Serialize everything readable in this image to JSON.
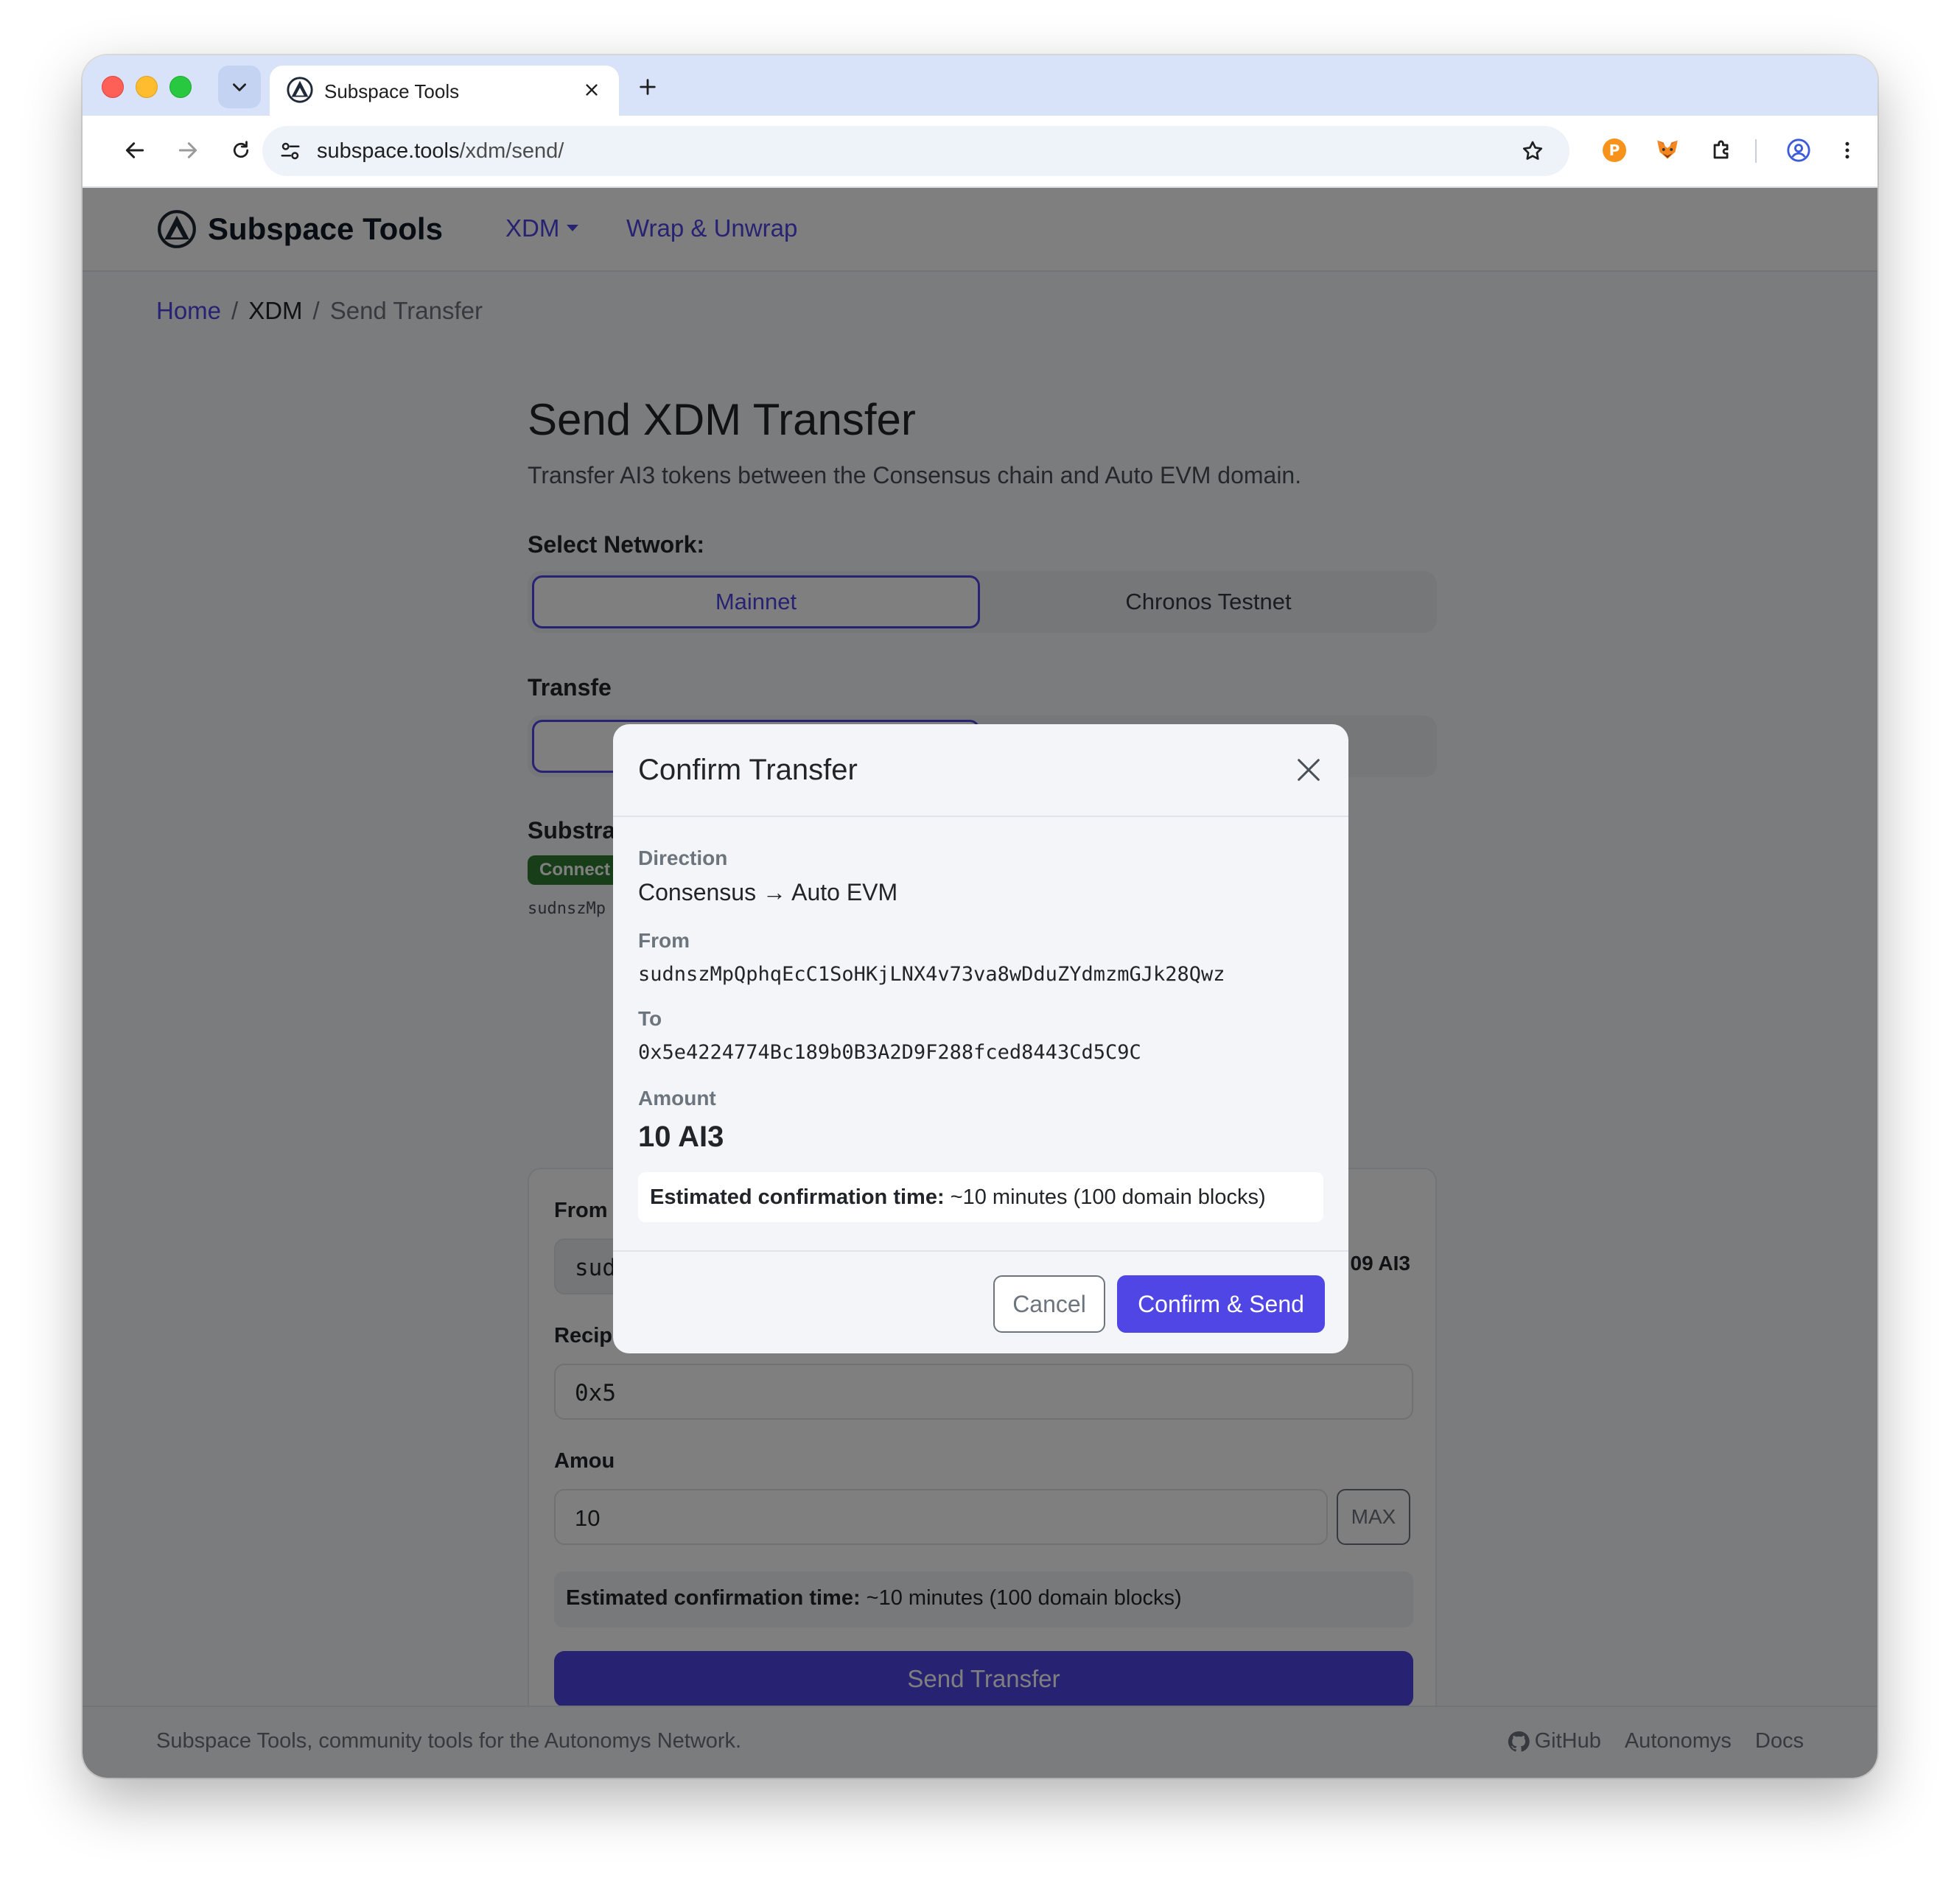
{
  "browser": {
    "tab_title": "Subspace Tools",
    "url_host": "subspace.tools",
    "url_path": "/xdm/send/"
  },
  "nav": {
    "brand": "Subspace Tools",
    "links": [
      "XDM",
      "Wrap & Unwrap"
    ]
  },
  "breadcrumb": [
    "Home",
    "XDM",
    "Send Transfer"
  ],
  "main": {
    "title": "Send XDM Transfer",
    "subtitle": "Transfer AI3 tokens between the Consensus chain and Auto EVM domain.",
    "network_label": "Select Network:",
    "networks": [
      "Mainnet",
      "Chronos Testnet"
    ],
    "transfer_label_partial": "Transfe",
    "substrate_label_partial": "Substra",
    "connected_badge_partial": "Connect",
    "substrate_addr_partial": "sudnszMp",
    "form": {
      "from_label": "From",
      "from_value_partial": "sud",
      "balance_partial": "09 AI3",
      "recipient_label_partial": "Recipi",
      "recipient_value_partial": "0x5",
      "amount_label_partial": "Amou",
      "amount_value": "10",
      "max_label": "MAX",
      "est_label": "Estimated confirmation time:",
      "est_value": " ~10 minutes (100 domain blocks)",
      "send_label": "Send Transfer"
    }
  },
  "modal": {
    "title": "Confirm Transfer",
    "direction_label": "Direction",
    "direction_value": "Consensus → Auto EVM",
    "from_label": "From",
    "from_value": "sudnszMpQphqEcC1SoHKjLNX4v73va8wDduZYdmzmGJk28Qwz",
    "to_label": "To",
    "to_value": "0x5e4224774Bc189b0B3A2D9F288fced8443Cd5C9C",
    "amount_label": "Amount",
    "amount_value": "10 AI3",
    "est_label": "Estimated confirmation time:",
    "est_value": " ~10 minutes (100 domain blocks)",
    "cancel_label": "Cancel",
    "confirm_label": "Confirm & Send"
  },
  "footer": {
    "text": "Subspace Tools, community tools for the Autonomys Network.",
    "links": [
      "GitHub",
      "Autonomys",
      "Docs"
    ]
  },
  "colors": {
    "accent": "#4f46e5",
    "success": "#2e7d32",
    "backdrop": "rgba(0,0,0,0.5)"
  }
}
